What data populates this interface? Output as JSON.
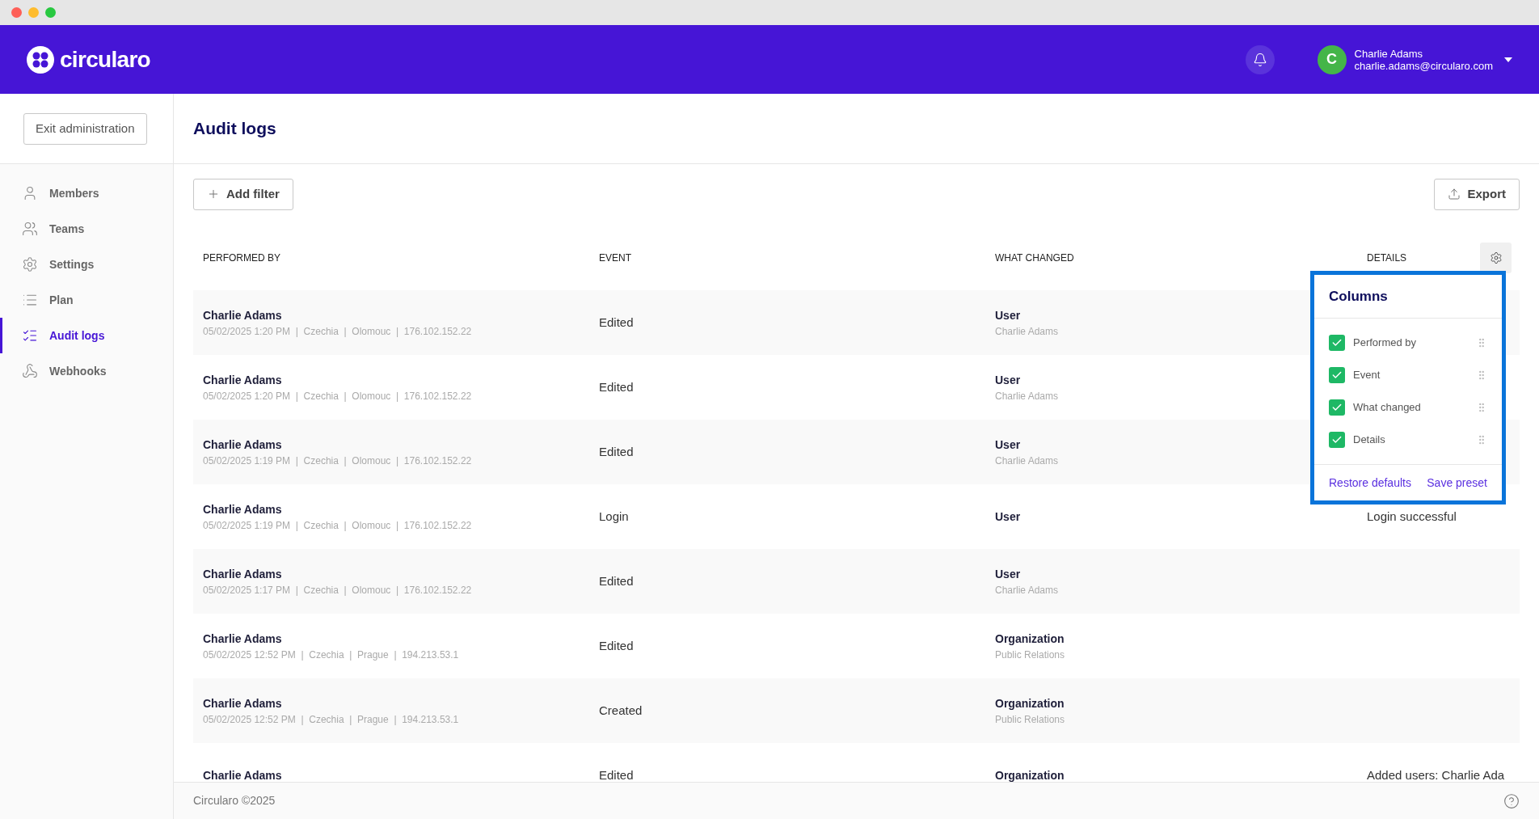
{
  "header": {
    "logo": "circularo",
    "user": {
      "initial": "C",
      "name": "Charlie Adams",
      "email": "charlie.adams@circularo.com"
    }
  },
  "sidebar": {
    "exit_button": "Exit administration",
    "items": [
      {
        "label": "Members",
        "selected": false
      },
      {
        "label": "Teams",
        "selected": false
      },
      {
        "label": "Settings",
        "selected": false
      },
      {
        "label": "Plan",
        "selected": false
      },
      {
        "label": "Audit logs",
        "selected": true
      },
      {
        "label": "Webhooks",
        "selected": false
      }
    ]
  },
  "page": {
    "title": "Audit logs",
    "add_filter": "Add filter",
    "export": "Export"
  },
  "table": {
    "columns": [
      "PERFORMED BY",
      "EVENT",
      "WHAT CHANGED",
      "DETAILS"
    ],
    "rows": [
      {
        "name": "Charlie Adams",
        "meta": "05/02/2025 1:20 PM  |  Czechia  |  Olomouc  |  176.102.152.22",
        "event": "Edited",
        "target": "User",
        "target_sub": "Charlie Adams"
      },
      {
        "name": "Charlie Adams",
        "meta": "05/02/2025 1:20 PM  |  Czechia  |  Olomouc  |  176.102.152.22",
        "event": "Edited",
        "target": "User",
        "target_sub": "Charlie Adams"
      },
      {
        "name": "Charlie Adams",
        "meta": "05/02/2025 1:19 PM  |  Czechia  |  Olomouc  |  176.102.152.22",
        "event": "Edited",
        "target": "User",
        "target_sub": "Charlie Adams"
      },
      {
        "name": "Charlie Adams",
        "meta": "05/02/2025 1:19 PM  |  Czechia  |  Olomouc  |  176.102.152.22",
        "event": "Login",
        "target": "User",
        "details": "Login successful"
      },
      {
        "name": "Charlie Adams",
        "meta": "05/02/2025 1:17 PM  |  Czechia  |  Olomouc  |  176.102.152.22",
        "event": "Edited",
        "target": "User",
        "target_sub": "Charlie Adams"
      },
      {
        "name": "Charlie Adams",
        "meta": "05/02/2025 12:52 PM  |  Czechia  |  Prague  |  194.213.53.1",
        "event": "Edited",
        "target": "Organization",
        "target_sub": "Public Relations"
      },
      {
        "name": "Charlie Adams",
        "meta": "05/02/2025 12:52 PM  |  Czechia  |  Prague  |  194.213.53.1",
        "event": "Created",
        "target": "Organization",
        "target_sub": "Public Relations"
      },
      {
        "name": "Charlie Adams",
        "event": "Edited",
        "target": "Organization",
        "details": "Added users: Charlie Ada"
      }
    ]
  },
  "columns_menu": {
    "title": "Columns",
    "items": [
      {
        "label": "Performed by",
        "checked": true
      },
      {
        "label": "Event",
        "checked": true
      },
      {
        "label": "What changed",
        "checked": true
      },
      {
        "label": "Details",
        "checked": true
      }
    ],
    "restore": "Restore defaults",
    "save": "Save preset"
  },
  "footer": {
    "copyright": "Circularo ©2025"
  }
}
